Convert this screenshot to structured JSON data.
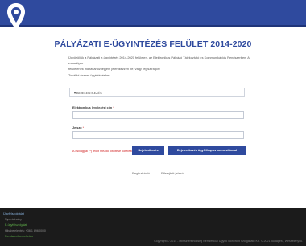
{
  "header": {
    "logo_icon": "location-pin-logo-icon",
    "brand_color": "#2f4a9e"
  },
  "main": {
    "title": "PÁLYÁZATI E-ÜGYINTÉZÉS FELÜLET 2014-2020",
    "intro_line1": "Üdvözöljük a Pályázati e-ügyintézés 2014-2020 felületen, az Elektronikus Pályázó Tájékoztató és Kommunikációs Rendszerben! A személyes",
    "intro_line2": "felületének indításához lépjen, jelentkezzen be, vagy regisztráljon!",
    "login_note": "További üzenet ügyintézéshez"
  },
  "login": {
    "section_title": "▾ BEJELENTKEZÉS",
    "email_label": "Elektronikus levelezési cím",
    "email_required": "*",
    "password_label": "Jelszó",
    "password_required": "*",
    "required_note": "A csillaggal (*) jelölt mezők kitöltése kötelező.",
    "login_button": "Bejelentkezés",
    "gov_login_button": "Bejelentkezés ügyfélkapus azonosítással",
    "register_link": "Regisztráció",
    "forgot_link": "Elfelejtett jelszó"
  },
  "footer": {
    "heading": "Ügyfélszolgálat",
    "line1": "Nyomtatvány",
    "line2": "E-ügyfélszolgálat",
    "line3": "Hibabejelentés: +36 1 896 0000",
    "line4": "Rendszerüzemeltetés",
    "copyright": "Copyright © 2014 - Miniszterelnökség Nemzetközi Ügyek Nonprofit Szolgáltató Kft. © 2021 Budapest, Wesselényi u.",
    "accent_green": "#5fae4a"
  }
}
